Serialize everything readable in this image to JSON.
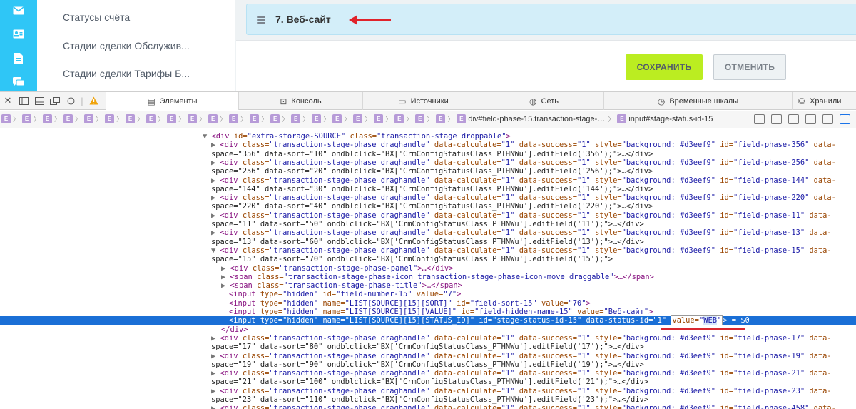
{
  "app": {
    "menu_items": [
      "Статусы счёта",
      "Стадии сделки Обслужив...",
      "Стадии сделки Тарифы Б..."
    ],
    "stage_title": "7. Веб-сайт",
    "save_label": "СОХРАНИТЬ",
    "cancel_label": "ОТМЕНИТЬ",
    "accent_color": "#2fc6f6",
    "save_color": "#bbed21"
  },
  "devtools": {
    "tabs": [
      "Элементы",
      "Консоль",
      "Источники",
      "Сеть",
      "Временные шкалы",
      "Хранили"
    ],
    "active_tab": "Элементы",
    "crumb_marker": "E",
    "crumb_main": "div#field-phase-15.transaction-stage-…",
    "crumb_last": "input#stage-status-id-15",
    "lines": [
      {
        "i": 0,
        "tri": "▼",
        "t1": "<div ",
        "a1": "id=",
        "v1": "\"extra-storage-SOURCE\"",
        "a2": " class=",
        "v2": "\"transaction-stage droppable\"",
        "t2": ">"
      },
      {
        "i": 1,
        "tri": "▶",
        "t1": "<div ",
        "a1": "class=",
        "v1": "\"transaction-stage-phase draghandle\"",
        "a2": " data-calculate=",
        "v2": "\"1\"",
        "a3": " data-success=",
        "v3": "\"1\"",
        "a4": " style=",
        "v4": "\"background: #d3eef9\"",
        "a5": " id=",
        "v5": "\"field-phase-356\"",
        "a6": " data-",
        "t2": ""
      },
      {
        "i": 2,
        "cont": "space=\"356\" data-sort=\"10\" ondblclick=\"BX['CrmConfigStatusClass_PTHNWu'].editField('356');\">…</div>"
      },
      {
        "i": 1,
        "tri": "▶",
        "t1": "<div ",
        "a1": "class=",
        "v1": "\"transaction-stage-phase draghandle\"",
        "a2": " data-calculate=",
        "v2": "\"1\"",
        "a3": " data-success=",
        "v3": "\"1\"",
        "a4": " style=",
        "v4": "\"background: #d3eef9\"",
        "a5": " id=",
        "v5": "\"field-phase-256\"",
        "a6": " data-",
        "t2": ""
      },
      {
        "i": 2,
        "cont": "space=\"256\" data-sort=\"20\" ondblclick=\"BX['CrmConfigStatusClass_PTHNWu'].editField('256');\">…</div>"
      },
      {
        "i": 1,
        "tri": "▶",
        "t1": "<div ",
        "a1": "class=",
        "v1": "\"transaction-stage-phase draghandle\"",
        "a2": " data-calculate=",
        "v2": "\"1\"",
        "a3": " data-success=",
        "v3": "\"1\"",
        "a4": " style=",
        "v4": "\"background: #d3eef9\"",
        "a5": " id=",
        "v5": "\"field-phase-144\"",
        "a6": " data-",
        "t2": ""
      },
      {
        "i": 2,
        "cont": "space=\"144\" data-sort=\"30\" ondblclick=\"BX['CrmConfigStatusClass_PTHNWu'].editField('144');\">…</div>"
      },
      {
        "i": 1,
        "tri": "▶",
        "t1": "<div ",
        "a1": "class=",
        "v1": "\"transaction-stage-phase draghandle\"",
        "a2": " data-calculate=",
        "v2": "\"1\"",
        "a3": " data-success=",
        "v3": "\"1\"",
        "a4": " style=",
        "v4": "\"background: #d3eef9\"",
        "a5": " id=",
        "v5": "\"field-phase-220\"",
        "a6": " data-",
        "t2": ""
      },
      {
        "i": 2,
        "cont": "space=\"220\" data-sort=\"40\" ondblclick=\"BX['CrmConfigStatusClass_PTHNWu'].editField('220');\">…</div>"
      },
      {
        "i": 1,
        "tri": "▶",
        "t1": "<div ",
        "a1": "class=",
        "v1": "\"transaction-stage-phase draghandle\"",
        "a2": " data-calculate=",
        "v2": "\"1\"",
        "a3": " data-success=",
        "v3": "\"1\"",
        "a4": " style=",
        "v4": "\"background: #d3eef9\"",
        "a5": " id=",
        "v5": "\"field-phase-11\"",
        "a6": " data-",
        "t2": ""
      },
      {
        "i": 2,
        "cont": "space=\"11\" data-sort=\"50\" ondblclick=\"BX['CrmConfigStatusClass_PTHNWu'].editField('11');\">…</div>"
      },
      {
        "i": 1,
        "tri": "▶",
        "t1": "<div ",
        "a1": "class=",
        "v1": "\"transaction-stage-phase draghandle\"",
        "a2": " data-calculate=",
        "v2": "\"1\"",
        "a3": " data-success=",
        "v3": "\"1\"",
        "a4": " style=",
        "v4": "\"background: #d3eef9\"",
        "a5": " id=",
        "v5": "\"field-phase-13\"",
        "a6": " data-",
        "t2": ""
      },
      {
        "i": 2,
        "cont": "space=\"13\" data-sort=\"60\" ondblclick=\"BX['CrmConfigStatusClass_PTHNWu'].editField('13');\">…</div>"
      },
      {
        "i": 1,
        "tri": "▼",
        "t1": "<div ",
        "a1": "class=",
        "v1": "\"transaction-stage-phase draghandle\"",
        "a2": " data-calculate=",
        "v2": "\"1\"",
        "a3": " data-success=",
        "v3": "\"1\"",
        "a4": " style=",
        "v4": "\"background: #d3eef9\"",
        "a5": " id=",
        "v5": "\"field-phase-15\"",
        "a6": " data-",
        "t2": ""
      },
      {
        "i": 2,
        "cont": "space=\"15\" data-sort=\"70\" ondblclick=\"BX['CrmConfigStatusClass_PTHNWu'].editField('15');\">"
      },
      {
        "i": 3,
        "tri": "▶",
        "t1": "<div ",
        "a1": "class=",
        "v1": "\"transaction-stage-phase-panel\"",
        "t2": ">…</div>"
      },
      {
        "i": 3,
        "tri": "▶",
        "t1": "<span ",
        "a1": "class=",
        "v1": "\"transaction-stage-phase-icon transaction-stage-phase-icon-move draggable\"",
        "t2": ">…</span>"
      },
      {
        "i": 3,
        "tri": "▶",
        "t1": "<span ",
        "a1": "class=",
        "v1": "\"transaction-stage-phase-title\"",
        "t2": ">…</span>"
      },
      {
        "i": 4,
        "t1": "<input ",
        "a1": "type=",
        "v1": "\"hidden\"",
        "a2": " id=",
        "v2": "\"field-number-15\"",
        "a3": " value=",
        "v3": "\"7\"",
        "t2": ">"
      },
      {
        "i": 4,
        "t1": "<input ",
        "a1": "type=",
        "v1": "\"hidden\"",
        "a2": " name=",
        "v2": "\"LIST[SOURCE][15][SORT]\"",
        "a3": " id=",
        "v3": "\"field-sort-15\"",
        "a4": " value=",
        "v4": "\"70\"",
        "t2": ">"
      },
      {
        "i": 4,
        "t1": "<input ",
        "a1": "type=",
        "v1": "\"hidden\"",
        "a2": " name=",
        "v2": "\"LIST[SOURCE][15][VALUE]\"",
        "a3": " id=",
        "v3": "\"field-hidden-name-15\"",
        "a4": " value=",
        "v4": "\"Веб-сайт\"",
        "t2": ">"
      },
      {
        "i": 4,
        "sel": true,
        "t1": "<input ",
        "a1": "type=",
        "v1": "\"hidden\"",
        "a2": " name=",
        "v2": "\"LIST[SOURCE][15][STATUS_ID]\"",
        "a3": " id=",
        "v3": "\"stage-status-id-15\"",
        "a4": " data-status-id=",
        "v4": "\"1\"",
        "hl_attr": "value=",
        "hl_q1": "\"",
        "hl_val": "WEB",
        "hl_q2": "\"",
        "tail": "> = $0"
      },
      {
        "i": 3,
        "t1": "</div>"
      },
      {
        "i": 1,
        "tri": "▶",
        "t1": "<div ",
        "a1": "class=",
        "v1": "\"transaction-stage-phase draghandle\"",
        "a2": " data-calculate=",
        "v2": "\"1\"",
        "a3": " data-success=",
        "v3": "\"1\"",
        "a4": " style=",
        "v4": "\"background: #d3eef9\"",
        "a5": " id=",
        "v5": "\"field-phase-17\"",
        "a6": " data-",
        "t2": ""
      },
      {
        "i": 2,
        "cont": "space=\"17\" data-sort=\"80\" ondblclick=\"BX['CrmConfigStatusClass_PTHNWu'].editField('17');\">…</div>"
      },
      {
        "i": 1,
        "tri": "▶",
        "t1": "<div ",
        "a1": "class=",
        "v1": "\"transaction-stage-phase draghandle\"",
        "a2": " data-calculate=",
        "v2": "\"1\"",
        "a3": " data-success=",
        "v3": "\"1\"",
        "a4": " style=",
        "v4": "\"background: #d3eef9\"",
        "a5": " id=",
        "v5": "\"field-phase-19\"",
        "a6": " data-",
        "t2": ""
      },
      {
        "i": 2,
        "cont": "space=\"19\" data-sort=\"90\" ondblclick=\"BX['CrmConfigStatusClass_PTHNWu'].editField('19');\">…</div>"
      },
      {
        "i": 1,
        "tri": "▶",
        "t1": "<div ",
        "a1": "class=",
        "v1": "\"transaction-stage-phase draghandle\"",
        "a2": " data-calculate=",
        "v2": "\"1\"",
        "a3": " data-success=",
        "v3": "\"1\"",
        "a4": " style=",
        "v4": "\"background: #d3eef9\"",
        "a5": " id=",
        "v5": "\"field-phase-21\"",
        "a6": " data-",
        "t2": ""
      },
      {
        "i": 2,
        "cont": "space=\"21\" data-sort=\"100\" ondblclick=\"BX['CrmConfigStatusClass_PTHNWu'].editField('21');\">…</div>"
      },
      {
        "i": 1,
        "tri": "▶",
        "t1": "<div ",
        "a1": "class=",
        "v1": "\"transaction-stage-phase draghandle\"",
        "a2": " data-calculate=",
        "v2": "\"1\"",
        "a3": " data-success=",
        "v3": "\"1\"",
        "a4": " style=",
        "v4": "\"background: #d3eef9\"",
        "a5": " id=",
        "v5": "\"field-phase-23\"",
        "a6": " data-",
        "t2": ""
      },
      {
        "i": 2,
        "cont": "space=\"23\" data-sort=\"110\" ondblclick=\"BX['CrmConfigStatusClass_PTHNWu'].editField('23');\">…</div>"
      },
      {
        "i": 1,
        "tri": "▶",
        "t1": "<div ",
        "a1": "class=",
        "v1": "\"transaction-stage-phase draghandle\"",
        "a2": " data-calculate=",
        "v2": "\"1\"",
        "a3": " data-success=",
        "v3": "\"1\"",
        "a4": " style=",
        "v4": "\"background: #d3eef9\"",
        "a5": " id=",
        "v5": "\"field-phase-458\"",
        "a6": " data-",
        "t2": ""
      }
    ]
  }
}
